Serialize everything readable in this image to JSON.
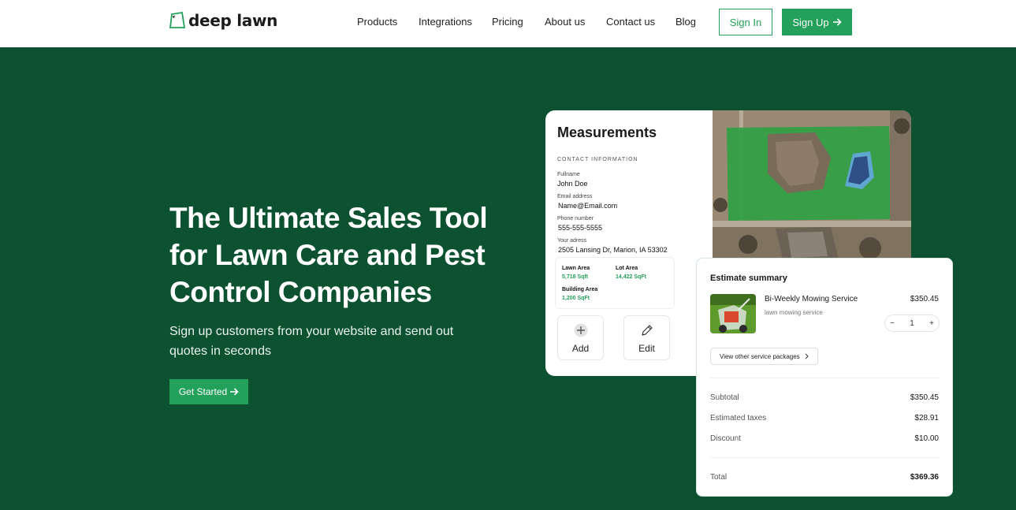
{
  "header": {
    "logo_text": "deep lawn",
    "nav": [
      "Products",
      "Integrations",
      "Pricing",
      "About us",
      "Contact us",
      "Blog"
    ],
    "signin_label": "Sign In",
    "signup_label": "Sign Up",
    "accent": "#23a05a"
  },
  "hero": {
    "title": "The Ultimate Sales Tool for Lawn Care and Pest Control Companies",
    "subtitle": "Sign up customers from your website and send out quotes in seconds",
    "cta_label": "Get Started",
    "background": "#0d5230"
  },
  "measurements": {
    "title": "Measurements",
    "section_label": "CONTACT INFORMATION",
    "fields": [
      {
        "label": "Fullname",
        "value": "John Doe"
      },
      {
        "label": "Email address",
        "value": "Name@Email.com"
      },
      {
        "label": "Phone number",
        "value": "555-555-5555"
      },
      {
        "label": "Your adress",
        "value": "2505 Lansing Dr, Marion, IA 53302"
      }
    ],
    "areas": [
      {
        "label": "Lawn Area",
        "value": "5,718 Sqft"
      },
      {
        "label": "Lot Area",
        "value": "14,422 SqFt"
      },
      {
        "label": "Building Area",
        "value": "1,200 SqFt"
      }
    ],
    "add_label": "Add",
    "edit_label": "Edit"
  },
  "estimate": {
    "title": "Estimate summary",
    "service_name": "Bi-Weekly Mowing Service",
    "service_desc": "lawn mowing service",
    "service_price": "$350.45",
    "quantity": "1",
    "packages_label": "View other service packages",
    "rows": [
      {
        "label": "Subtotal",
        "value": "$350.45"
      },
      {
        "label": "Estimated taxes",
        "value": "$28.91"
      },
      {
        "label": "Discount",
        "value": "$10.00"
      }
    ],
    "total_label": "Total",
    "total_value": "$369.36"
  }
}
